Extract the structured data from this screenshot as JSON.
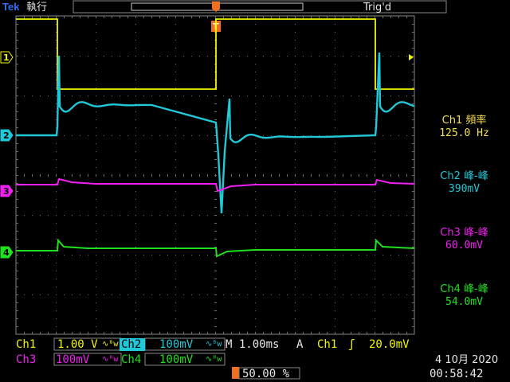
{
  "header": {
    "brand": "Tek",
    "run_state": "執行",
    "trigger_status": "Trig'd",
    "trigger_marker": "T"
  },
  "channels": [
    {
      "id": "1",
      "color": "#f5f500"
    },
    {
      "id": "2",
      "color": "#20c8d8"
    },
    {
      "id": "3",
      "color": "#f020f0"
    },
    {
      "id": "4",
      "color": "#20e020"
    }
  ],
  "measurements": [
    {
      "label": "Ch1 頻率",
      "value": "125.0 Hz",
      "color": "#f5e050"
    },
    {
      "label": "Ch2 峰-峰",
      "value": "390mV",
      "color": "#20c8d8"
    },
    {
      "label": "Ch3 峰-峰",
      "value": "60.0mV",
      "color": "#f020f0"
    },
    {
      "label": "Ch4 峰-峰",
      "value": "54.0mV",
      "color": "#20e020"
    }
  ],
  "settings": {
    "ch1_label": "Ch1",
    "ch1_scale": "1.00 V",
    "ch2_label": "Ch2",
    "ch2_scale": "100mV",
    "ch3_label": "Ch3",
    "ch3_scale": "100mV",
    "ch4_label": "Ch4",
    "ch4_scale": "100mV",
    "bw_symbol": "∿ᴮw",
    "timebase": "M 1.00ms",
    "trigger_mode": "A",
    "trigger_source": "Ch1",
    "trigger_slope": "ʃ",
    "trigger_level": "20.0mV",
    "trigger_position": "50.00 %",
    "date": "4 10月 2020",
    "time": "00:58:42"
  }
}
